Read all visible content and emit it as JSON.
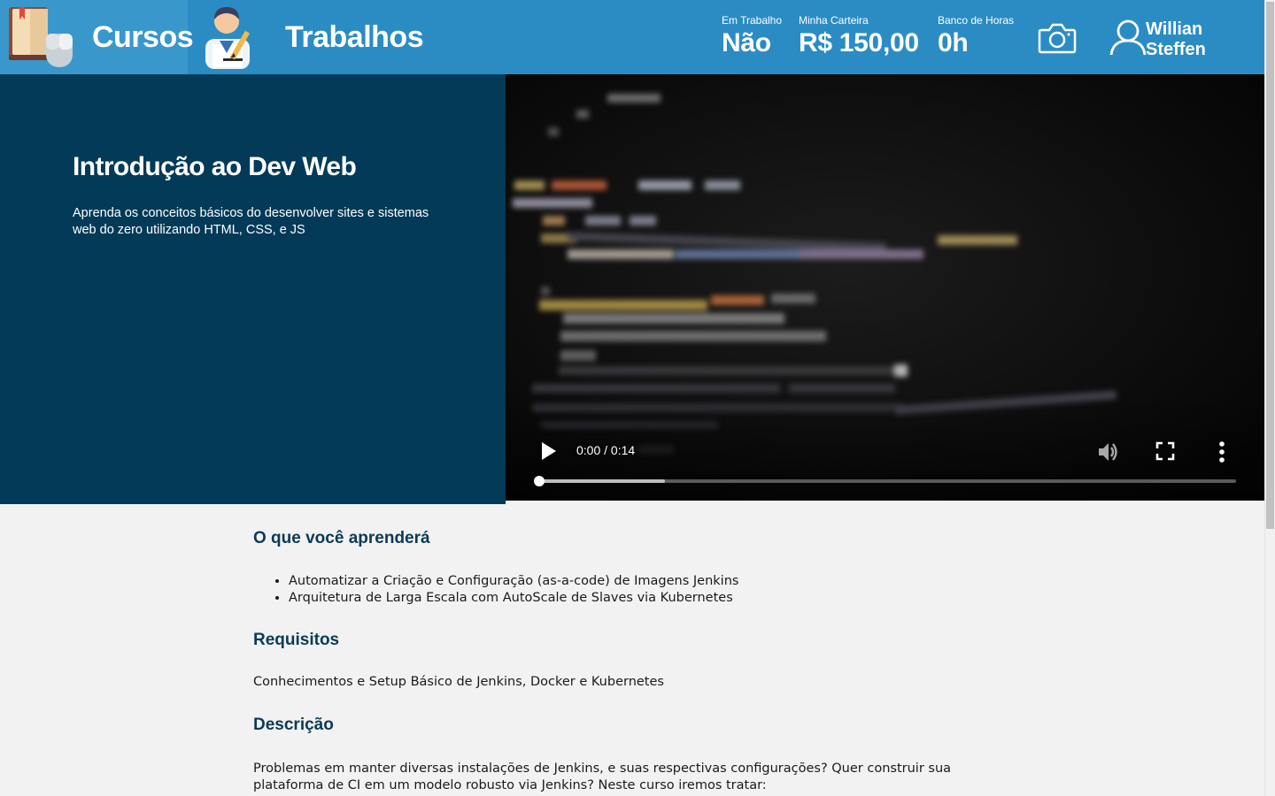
{
  "header": {
    "nav": [
      {
        "label": "Cursos",
        "icon": "books-mouse-icon"
      },
      {
        "label": "Trabalhos",
        "icon": "worker-writing-icon"
      }
    ],
    "stats": {
      "em_trabalho": {
        "label": "Em Trabalho",
        "value": "Não"
      },
      "carteira": {
        "label": "Minha Carteira",
        "value": "R$ 150,00"
      },
      "banco_horas": {
        "label": "Banco de Horas",
        "value": "0h"
      }
    },
    "camera_icon": "camera-icon",
    "user": {
      "name": "Willian Steffen",
      "icon": "user-icon"
    }
  },
  "hero": {
    "title": "Introdução ao Dev Web",
    "subtitle": "Aprenda os conceitos básicos do desenvolver sites e sistemas web do zero utilizando HTML, CSS, e JS",
    "video": {
      "time": "0:00 / 0:14",
      "buffered_fraction": 0.18,
      "played_fraction": 0.0
    }
  },
  "content": {
    "learn_title": "O que você aprenderá",
    "learn_items": [
      "Automatizar a Criação e Configuração (as-a-code) de Imagens Jenkins",
      "Arquitetura de Larga Escala com AutoScale de Slaves via Kubernetes"
    ],
    "req_title": "Requisitos",
    "req_text": "Conhecimentos e Setup Básico de Jenkins, Docker e Kubernetes",
    "desc_title": "Descrição",
    "desc_text": "Problemas em manter diversas instalações de Jenkins, e suas respectivas configurações? Quer construir sua plataforma de CI em um modelo robusto via Jenkins? Neste curso iremos tratar:"
  },
  "colors": {
    "header": "#2b8cc4",
    "hero_left": "#023a58",
    "section_title": "#0b3a57",
    "page_bg": "#f2f2f2"
  }
}
